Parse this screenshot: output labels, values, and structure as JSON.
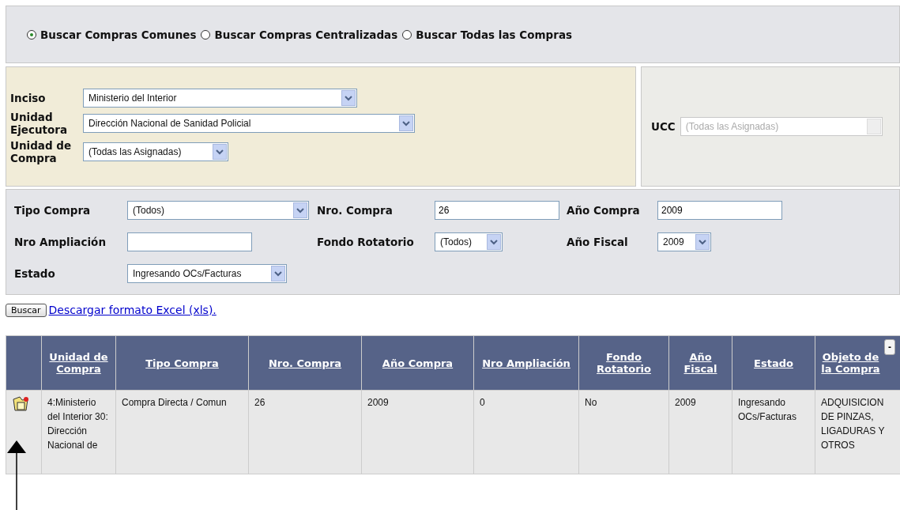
{
  "search_scope": [
    {
      "label": "Buscar Compras Comunes",
      "selected": true
    },
    {
      "label": "Buscar Compras Centralizadas",
      "selected": false
    },
    {
      "label": "Buscar Todas las Compras",
      "selected": false
    }
  ],
  "org_filters": [
    {
      "label": "Inciso",
      "value": "Ministerio del Interior"
    },
    {
      "label": "Unidad Ejecutora",
      "value": "Dirección Nacional de Sanidad Policial"
    },
    {
      "label": "Unidad de Compra",
      "value": "(Todas las Asignadas)"
    }
  ],
  "ucc": {
    "label": "UCC",
    "value": "(Todas las Asignadas)",
    "disabled": true
  },
  "filters": [
    [
      {
        "label": "Tipo Compra",
        "value": "(Todos)",
        "kind": "select"
      },
      {
        "label": "Nro. Compra",
        "value": "26",
        "kind": "input"
      },
      {
        "label": "Año Compra",
        "value": "2009",
        "kind": "input"
      }
    ],
    [
      {
        "label": "Nro Ampliación",
        "kind": "input"
      },
      {
        "label": "Fondo Rotatorio",
        "value": "(Todos)",
        "kind": "select"
      },
      {
        "label": "Año Fiscal",
        "value": "2009",
        "kind": "select"
      }
    ],
    [
      {
        "label": "Estado",
        "value": "Ingresando OCs/Facturas",
        "kind": "select"
      }
    ]
  ],
  "search_button": "Buscar",
  "export_link": "Descargar formato Excel (xls).",
  "table": {
    "columns": [
      "Unidad de Compra",
      "Tipo Compra",
      "Nro. Compra",
      "Año Compra",
      "Nro Ampliación",
      "Fondo Rotatorio",
      "Año Fiscal",
      "Estado",
      "Objeto de la Compra"
    ],
    "collapse_button": "-",
    "rows": [
      {
        "cells": [
          "4:Ministerio del Interior 30: Dirección Nacional de",
          "Compra Directa / Comun",
          "26",
          "2009",
          "0",
          "No",
          "2009",
          "Ingresando OCs/Facturas",
          "ADQUISICION DE PINZAS, LIGADURAS Y OTROS"
        ]
      }
    ]
  }
}
